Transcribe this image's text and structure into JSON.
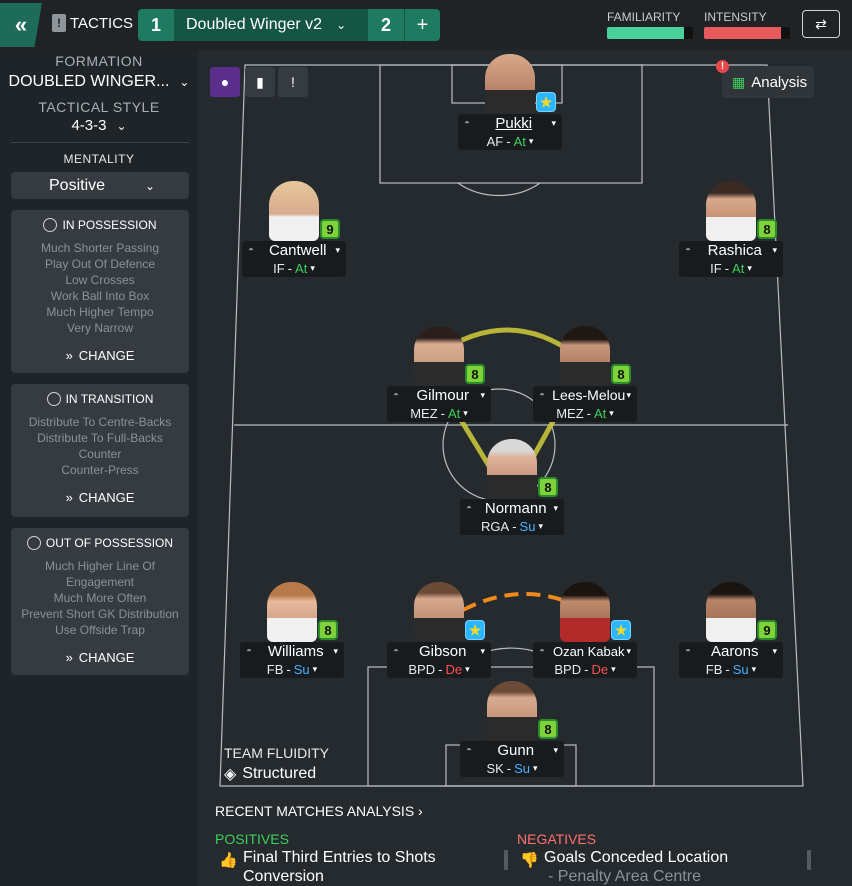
{
  "topbar": {
    "back_icon": "double-chevron-left-icon",
    "tactics_label": "TACTICS",
    "tab1_num": "1",
    "tab1_name": "Doubled Winger v2",
    "tab2_num": "2",
    "add_label": "+",
    "familiarity_label": "FAMILIARITY",
    "familiarity_level": 0.9,
    "intensity_label": "INTENSITY",
    "intensity_level": 0.9,
    "swap_icon": "swap-icon"
  },
  "sidebar": {
    "formation_head": "FORMATION",
    "formation_val": "DOUBLED WINGER...",
    "style_head": "TACTICAL STYLE",
    "style_val": "4-3-3",
    "mentality_head": "MENTALITY",
    "mentality_val": "Positive",
    "in_possession": {
      "title": "IN POSSESSION",
      "items": [
        "Much Shorter Passing",
        "Play Out Of Defence",
        "Low Crosses",
        "Work Ball Into Box",
        "Much Higher Tempo",
        "Very Narrow"
      ],
      "change": "CHANGE"
    },
    "in_transition": {
      "title": "IN TRANSITION",
      "items": [
        "Distribute To Centre-Backs",
        "Distribute To Full-Backs",
        "Counter",
        "Counter-Press"
      ],
      "change": "CHANGE"
    },
    "out_of_possession": {
      "title": "OUT OF POSSESSION",
      "items": [
        "Much Higher Line Of",
        "Engagement",
        "Much More Often",
        "Prevent Short GK Distribution",
        "Use Offside Trap"
      ],
      "change": "CHANGE"
    }
  },
  "pitch": {
    "analysis_label": "Analysis",
    "alert": "!",
    "players": [
      {
        "name": "Pukki",
        "role": "AF",
        "duty": "At",
        "badge": "star"
      },
      {
        "name": "Cantwell",
        "role": "IF",
        "duty": "At",
        "badge": "9"
      },
      {
        "name": "Rashica",
        "role": "IF",
        "duty": "At",
        "badge": "8"
      },
      {
        "name": "Gilmour",
        "role": "MEZ",
        "duty": "At",
        "badge": "8"
      },
      {
        "name": "Lees-Melou",
        "role": "MEZ",
        "duty": "At",
        "badge": "8"
      },
      {
        "name": "Normann",
        "role": "RGA",
        "duty": "Su",
        "badge": "8"
      },
      {
        "name": "Williams",
        "role": "FB",
        "duty": "Su",
        "badge": "8"
      },
      {
        "name": "Gibson",
        "role": "BPD",
        "duty": "De",
        "badge": "star"
      },
      {
        "name": "Ozan Kabak",
        "role": "BPD",
        "duty": "De",
        "badge": "star"
      },
      {
        "name": "Aarons",
        "role": "FB",
        "duty": "Su",
        "badge": "9"
      },
      {
        "name": "Gunn",
        "role": "SK",
        "duty": "Su",
        "badge": "8"
      }
    ],
    "fluidity_label": "TEAM FLUIDITY",
    "fluidity_val": "Structured"
  },
  "analysis": {
    "title": "RECENT MATCHES ANALYSIS",
    "positives_label": "POSITIVES",
    "positive_item": "Final Third Entries to Shots Conversion",
    "negatives_label": "NEGATIVES",
    "negative_item": "Goals Conceded Location",
    "negative_sub": "- Penalty Area Centre"
  },
  "colors": {
    "accent": "#1f7a62",
    "attack": "#3ecf5c",
    "support": "#4ab0ff",
    "defend": "#ff4f4f",
    "link_yellow": "#c8c43a",
    "link_orange": "#f08a1c"
  }
}
